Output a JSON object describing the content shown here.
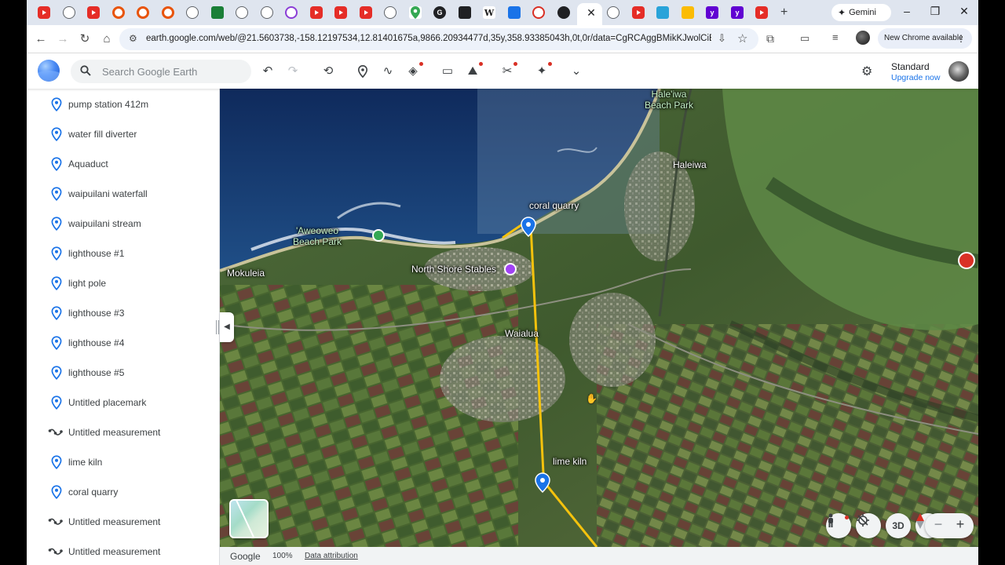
{
  "browser": {
    "active_tab_close": "✕",
    "new_tab": "+",
    "gemini_label": "Gemini",
    "url": "earth.google.com/web/@21.5603738,-158.12197534,12.81401675a,9866.20934477d,35y,358.93385043h,0t,0r/data=CgRCAggBMikKJwolCiExQ2xV...",
    "update_chip": "New Chrome available",
    "tab_icons": [
      "youtube-icon",
      "globe-icon",
      "youtube-icon",
      "c-icon",
      "c-icon",
      "c-icon",
      "globe-icon",
      "green-app-icon",
      "globe-icon",
      "globe-icon",
      "purple-icon",
      "youtube-icon",
      "youtube-icon",
      "youtube-icon",
      "gear-icon",
      "maps-icon",
      "google-icon",
      "dark-icon",
      "wikipedia-icon",
      "blue-app-icon",
      "red-icon",
      "dark-icon",
      "active-tab",
      "globe-icon",
      "youtube-icon",
      "blue-app-icon",
      "bag-icon",
      "yahoo-icon",
      "yahoo-icon",
      "youtube-icon"
    ]
  },
  "earth": {
    "search_placeholder": "Search Google Earth",
    "plan_name": "Standard",
    "plan_upgrade": "Upgrade now"
  },
  "sidebar": {
    "items": [
      {
        "type": "placemark",
        "label": "pump  station 412m"
      },
      {
        "type": "placemark",
        "label": "water fill diverter"
      },
      {
        "type": "placemark",
        "label": "Aquaduct"
      },
      {
        "type": "placemark",
        "label": "waipuilani waterfall"
      },
      {
        "type": "placemark",
        "label": "waipuilani stream"
      },
      {
        "type": "placemark",
        "label": "lighthouse #1"
      },
      {
        "type": "placemark",
        "label": "light pole"
      },
      {
        "type": "placemark",
        "label": "lighthouse #3"
      },
      {
        "type": "placemark",
        "label": "lighthouse #4"
      },
      {
        "type": "placemark",
        "label": "lighthouse #5"
      },
      {
        "type": "placemark",
        "label": "Untitled placemark"
      },
      {
        "type": "measurement",
        "label": "Untitled measurement"
      },
      {
        "type": "placemark",
        "label": "lime kiln"
      },
      {
        "type": "placemark",
        "label": "coral quarry"
      },
      {
        "type": "measurement",
        "label": "Untitled measurement"
      },
      {
        "type": "measurement",
        "label": "Untitled measurement"
      }
    ]
  },
  "map": {
    "labels": {
      "haleiwa_beach_park": "Hale'iwa Beach Park",
      "haleiwa": "Haleiwa",
      "coral_quarry": "coral quarry",
      "aweoweo_beach_park": "'Aweoweo Beach Park",
      "mokuleia": "Mokuleia",
      "north_shore_stables": "North Shore Stables",
      "waialua": "Waialua",
      "lime_kiln": "lime kiln"
    },
    "controls": {
      "three_d": "3D",
      "zoom_out": "−",
      "zoom_in": "+"
    },
    "path_color": "#f4c20d",
    "pin_color": "#1a73e8"
  },
  "footer": {
    "brand": "Google",
    "zoom": "100%",
    "attribution": "Data attribution"
  }
}
